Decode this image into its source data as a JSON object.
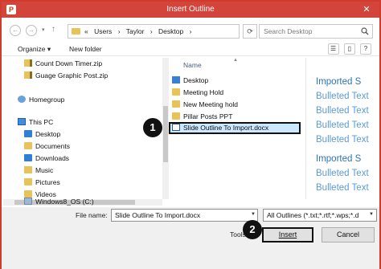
{
  "window": {
    "title": "Insert Outline",
    "close_glyph": "✕"
  },
  "toolbar": {
    "back_glyph": "←",
    "forward_glyph": "→",
    "up_glyph": "↑",
    "recent_glyph": "▾",
    "breadcrumb_prefix": "«",
    "breadcrumbs": [
      "Users",
      "Taylor",
      "Desktop"
    ],
    "separator": "›",
    "refresh_glyph": "⟳",
    "search_placeholder": "Search Desktop"
  },
  "commandbar": {
    "organize": "Organize ▾",
    "new_folder": "New folder",
    "view_glyph": "☰",
    "pane_glyph": "▯",
    "help_glyph": "?"
  },
  "navpane": {
    "items": [
      {
        "label": "Count Down Timer.zip",
        "icon": "zip-folder-icon"
      },
      {
        "label": "Guage Graphic Post.zip",
        "icon": "zip-folder-icon"
      },
      {
        "label": "Homegroup",
        "icon": "homegroup-icon"
      },
      {
        "label": "This PC",
        "icon": "pc-icon"
      },
      {
        "label": "Desktop",
        "icon": "desktop-folder-icon"
      },
      {
        "label": "Documents",
        "icon": "documents-folder-icon"
      },
      {
        "label": "Downloads",
        "icon": "downloads-folder-icon"
      },
      {
        "label": "Music",
        "icon": "music-folder-icon"
      },
      {
        "label": "Pictures",
        "icon": "pictures-folder-icon"
      },
      {
        "label": "Videos",
        "icon": "videos-folder-icon"
      },
      {
        "label": "Windows8_OS (C:)",
        "icon": "drive-icon"
      }
    ]
  },
  "filepane": {
    "column_name": "Name",
    "items": [
      {
        "label": "Desktop",
        "icon": "desktop-icon"
      },
      {
        "label": "Meeting Hold",
        "icon": "folder-icon"
      },
      {
        "label": "New Meeting hold",
        "icon": "folder-icon"
      },
      {
        "label": "Pillar Posts PPT",
        "icon": "folder-icon"
      },
      {
        "label": "Slide Outline To Import.docx",
        "icon": "word-document-icon",
        "selected": true
      }
    ]
  },
  "preview": {
    "lines": [
      {
        "text": "Imported S",
        "kind": "heading"
      },
      {
        "text": "Bulleted Text",
        "kind": "bullet"
      },
      {
        "text": "Bulleted Text",
        "kind": "bullet"
      },
      {
        "text": "Bulleted Text",
        "kind": "bullet"
      },
      {
        "text": "Bulleted Text",
        "kind": "bullet"
      },
      {
        "text": "Imported S",
        "kind": "heading"
      },
      {
        "text": "Bulleted Text",
        "kind": "bullet"
      },
      {
        "text": "Bulleted Text",
        "kind": "bullet"
      }
    ]
  },
  "bottom": {
    "file_name_label": "File name:",
    "file_name_value": "Slide Outline To Import.docx",
    "file_type_value": "All Outlines (*.txt;*.rtf;*.wps;*.d",
    "tools_label": "Tools",
    "insert_label": "Insert",
    "cancel_label": "Cancel"
  },
  "callouts": {
    "one": "1",
    "two": "2"
  },
  "colors": {
    "title_bar": "#d3443a",
    "preview_text": "#5b9bd5",
    "selection": "#cce8ff"
  }
}
